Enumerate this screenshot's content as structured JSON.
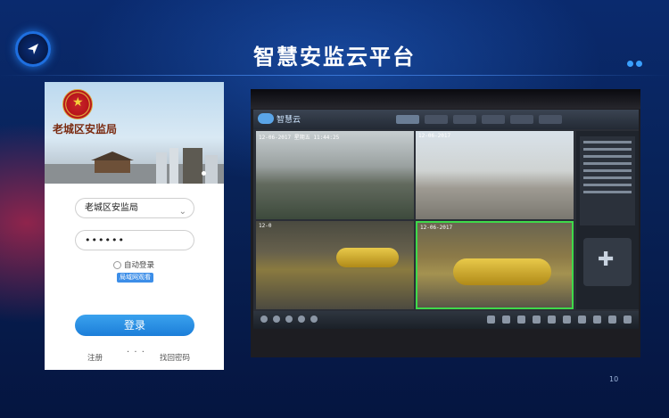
{
  "slide": {
    "title": "智慧安监云平台",
    "page_number": "10"
  },
  "login": {
    "org_name": "老城区安监局",
    "org_select_value": "老城区安监局",
    "password_value": "••••••",
    "remember_label": "自动登录",
    "lan_button_label": "局域网观看",
    "login_button_label": "登录",
    "register_link": "注册",
    "more_link": "· · ·",
    "forgot_link": "找回密码"
  },
  "monitor_screenshot": {
    "app_name": "智慧云",
    "cameras": [
      {
        "timestamp": "12-06-2017  星期五  11:44:25"
      },
      {
        "timestamp": "12-06-2017"
      },
      {
        "timestamp": "12-0"
      },
      {
        "timestamp": "12-06-2017"
      }
    ]
  },
  "colors": {
    "accent": "#1e6fe0",
    "login_button": "#2a90e5",
    "active_camera_border": "#3fd94a"
  }
}
